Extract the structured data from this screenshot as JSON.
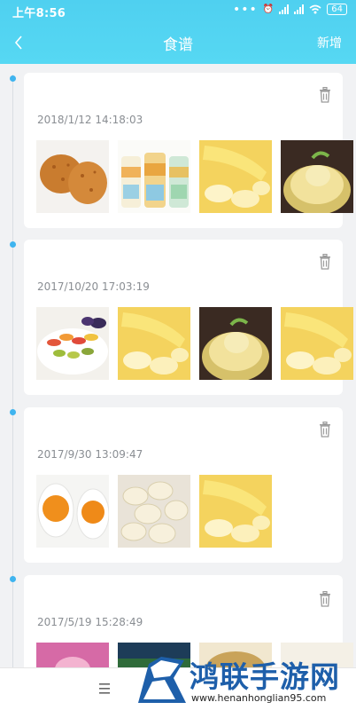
{
  "status": {
    "time": "上午8:56",
    "battery": "64"
  },
  "nav": {
    "title": "食谱",
    "action": "新增"
  },
  "records": [
    {
      "date": "2018/1/12 14:18:03",
      "photos": [
        "fried-chicken",
        "yogurt-bottles",
        "banana",
        "pomelo-fruit"
      ]
    },
    {
      "date": "2017/10/20 17:03:19",
      "photos": [
        "pasta-raisins",
        "banana",
        "pomelo-fruit",
        "banana"
      ]
    },
    {
      "date": "2017/9/30 13:09:47",
      "photos": [
        "salted-egg",
        "twisted-bread",
        "banana"
      ]
    },
    {
      "date": "2017/5/19 15:28:49",
      "photos": [
        "pink-dish",
        "green-dish",
        "soup",
        "pale-dish"
      ]
    }
  ],
  "watermark": {
    "title": "鸿联手游网",
    "url": "www.henanhonglian95.com"
  },
  "colors": {
    "header": "#52d4f2",
    "timeline_dot": "#3fb4ef",
    "date_text": "#8a8e93"
  }
}
